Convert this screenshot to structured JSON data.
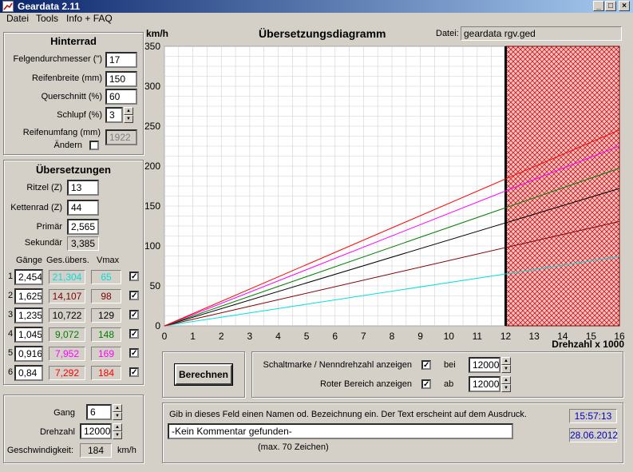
{
  "window": {
    "title": "Geardata 2.11"
  },
  "menu": [
    "Datei",
    "Tools",
    "Info + FAQ"
  ],
  "hinterrad": {
    "title": "Hinterrad",
    "felgen_label": "Felgendurchmesser (\")",
    "felgen_value": "17",
    "breite_label": "Reifenbreite (mm)",
    "breite_value": "150",
    "quer_label": "Querschnitt (%)",
    "quer_value": "60",
    "schlupf_label": "Schlupf (%)",
    "schlupf_value": "3",
    "umfang_label": "Reifenumfang (mm)",
    "aendern_label": "Ändern",
    "umfang_value": "1922"
  },
  "uebersetzungen": {
    "title": "Übersetzungen",
    "ritzel_label": "Ritzel (Z)",
    "ritzel_value": "13",
    "kette_label": "Kettenrad (Z)",
    "kette_value": "44",
    "primaer_label": "Primär",
    "primaer_value": "2,565",
    "sekundaer_label": "Sekundär",
    "sekundaer_value": "3,385",
    "col_gaenge": "Gänge",
    "col_ges": "Ges.übers.",
    "col_vmax": "Vmax",
    "gears": [
      {
        "n": "1",
        "ratio": "2,454",
        "total": "21,304",
        "vmax": "65",
        "color": "#00e0e0"
      },
      {
        "n": "2",
        "ratio": "1,625",
        "total": "14,107",
        "vmax": "98",
        "color": "#800000"
      },
      {
        "n": "3",
        "ratio": "1,235",
        "total": "10,722",
        "vmax": "129",
        "color": "#000000"
      },
      {
        "n": "4",
        "ratio": "1,045",
        "total": "9,072",
        "vmax": "148",
        "color": "#008000"
      },
      {
        "n": "5",
        "ratio": "0,916",
        "total": "7,952",
        "vmax": "169",
        "color": "#ff00ff"
      },
      {
        "n": "6",
        "ratio": "0,84",
        "total": "7,292",
        "vmax": "184",
        "color": "#ff0000"
      }
    ]
  },
  "gang": {
    "gang_label": "Gang",
    "gang_value": "6",
    "drehzahl_label": "Drehzahl",
    "drehzahl_value": "12000",
    "geschw_label": "Geschwindigkeit:",
    "geschw_value": "184",
    "geschw_unit": "km/h"
  },
  "header": {
    "unit": "km/h",
    "title": "Übersetzungsdiagramm",
    "datei_label": "Datei:",
    "datei_value": "geardata rgv.ged"
  },
  "chart_data": {
    "type": "line",
    "title": "Übersetzungsdiagramm",
    "ylabel": "km/h",
    "xlabel": "Drehzahl x 1000",
    "xlim": [
      0,
      16
    ],
    "ylim": [
      0,
      350
    ],
    "x_ticks": [
      "0",
      "1",
      "2",
      "3",
      "4",
      "5",
      "6",
      "7",
      "8",
      "9",
      "10",
      "11",
      "12",
      "13",
      "14",
      "15",
      "16"
    ],
    "y_ticks": [
      "0",
      "50",
      "100",
      "150",
      "200",
      "250",
      "300",
      "350"
    ],
    "grid": true,
    "red_zone_start": 12,
    "series": [
      {
        "color": "#00e0e0",
        "x": [
          0,
          16
        ],
        "y": [
          0,
          86.7
        ]
      },
      {
        "color": "#800000",
        "x": [
          0,
          16
        ],
        "y": [
          0,
          130.7
        ]
      },
      {
        "color": "#000000",
        "x": [
          0,
          16
        ],
        "y": [
          0,
          172
        ]
      },
      {
        "color": "#008000",
        "x": [
          0,
          16
        ],
        "y": [
          0,
          197.3
        ]
      },
      {
        "color": "#ff00ff",
        "x": [
          0,
          16
        ],
        "y": [
          0,
          225.3
        ]
      },
      {
        "color": "#ff0000",
        "x": [
          0,
          16
        ],
        "y": [
          0,
          245.3
        ]
      }
    ]
  },
  "controls": {
    "berechnen": "Berechnen",
    "schaltmarke_label": "Schaltmarke / Nenndrehzahl anzeigen",
    "bei_label": "bei",
    "bei_value": "12000",
    "roter_label": "Roter Bereich anzeigen",
    "ab_label": "ab",
    "ab_value": "12000"
  },
  "comment": {
    "hint": "Gib in dieses Feld einen Namen od. Bezeichnung ein. Der Text erscheint auf dem Ausdruck.",
    "value": "-Kein Kommentar gefunden-",
    "max": "(max. 70 Zeichen)",
    "time": "15:57:13",
    "date": "28.06.2012"
  }
}
